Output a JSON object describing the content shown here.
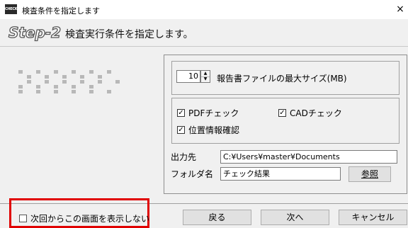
{
  "window": {
    "app_icon_text": "CHECK",
    "title": "検査条件を指定します",
    "close": "×"
  },
  "header": {
    "step_badge": "Step-2",
    "description": "検査実行条件を指定します。"
  },
  "report": {
    "max_size_value": "10",
    "max_size_label": "報告書ファイルの最大サイズ(MB)",
    "spin_up": "▲",
    "spin_down": "▼"
  },
  "checks": {
    "pdf": {
      "label": "PDFチェック",
      "checked": true,
      "mark": "✓"
    },
    "cad": {
      "label": "CADチェック",
      "checked": true,
      "mark": "✓"
    },
    "location": {
      "label": "位置情報確認",
      "checked": true,
      "mark": "✓"
    }
  },
  "output": {
    "destination_label": "出力先",
    "destination_value": "C:¥Users¥master¥Documents",
    "folder_label": "フォルダ名",
    "folder_value": "チェック結果",
    "browse_label": "参照"
  },
  "footer": {
    "dont_show_label": "次回からこの画面を表示しない",
    "dont_show_checked": false,
    "back_label": "戻る",
    "next_label": "次へ",
    "cancel_label": "キャンセル"
  },
  "colors": {
    "highlight_border": "#e00000"
  }
}
